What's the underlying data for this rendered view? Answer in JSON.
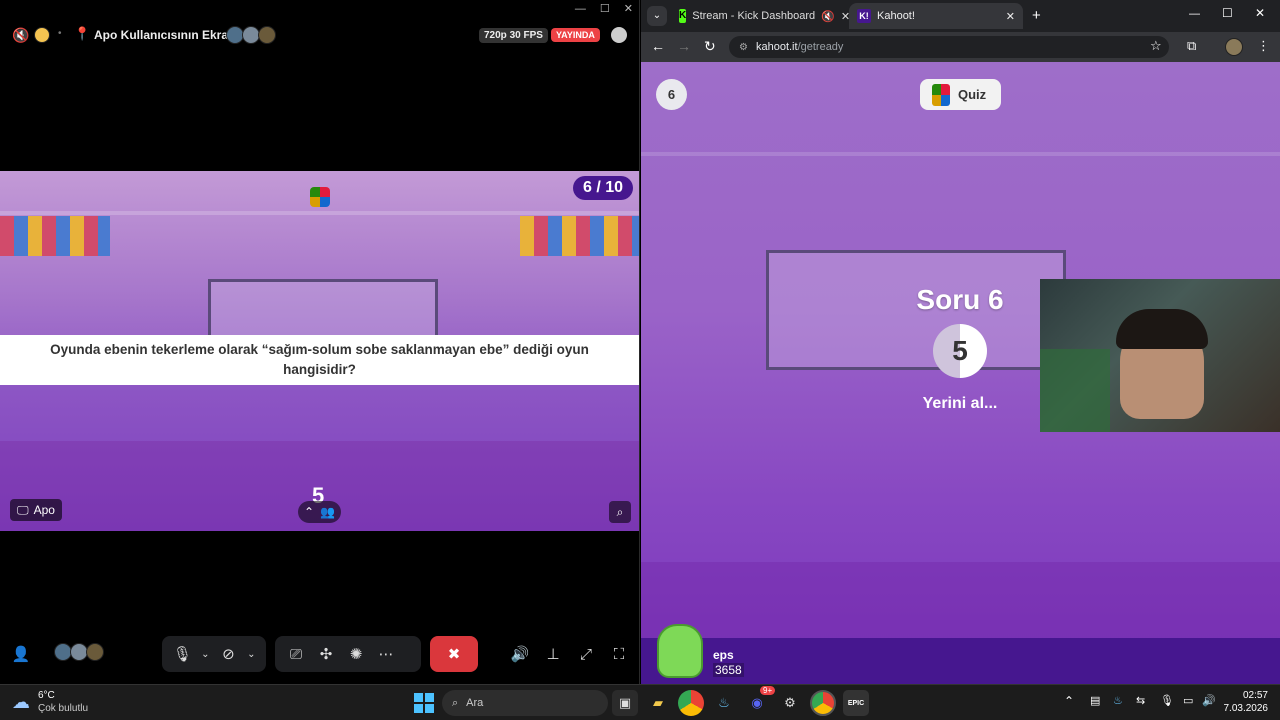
{
  "discord": {
    "title": "Apo Kullanıcısının Ekranı",
    "quality": "720p 30 FPS",
    "live": "YAYINDA",
    "stream_label": "Apo",
    "question_counter": "6 / 10",
    "question_text": "Oyunda ebenin tekerleme olarak “sağım-solum sobe saklanmayan ebe” dediği oyun hangisidir?",
    "timer_digit": "5"
  },
  "browser": {
    "tabs": [
      {
        "label": "Stream - Kick Dashboard"
      },
      {
        "label": "Kahoot!"
      }
    ],
    "url_host": "kahoot.it",
    "url_path": "/getready"
  },
  "kahoot": {
    "question_index": "6",
    "quiz_label": "Quiz",
    "heading": "Soru 6",
    "countdown": "5",
    "status": "Yerini al...",
    "player_name": "eps",
    "player_score": "3658"
  },
  "taskbar": {
    "weather_temp": "6°C",
    "weather_desc": "Çok bulutlu",
    "search_label": "Ara",
    "time": "02:57",
    "date": "7.03.2026",
    "notification_badge": "9+"
  },
  "colors": {
    "kahoot_purple": "#46178f",
    "live_red": "#ed4245",
    "end_call_red": "#da373c"
  }
}
